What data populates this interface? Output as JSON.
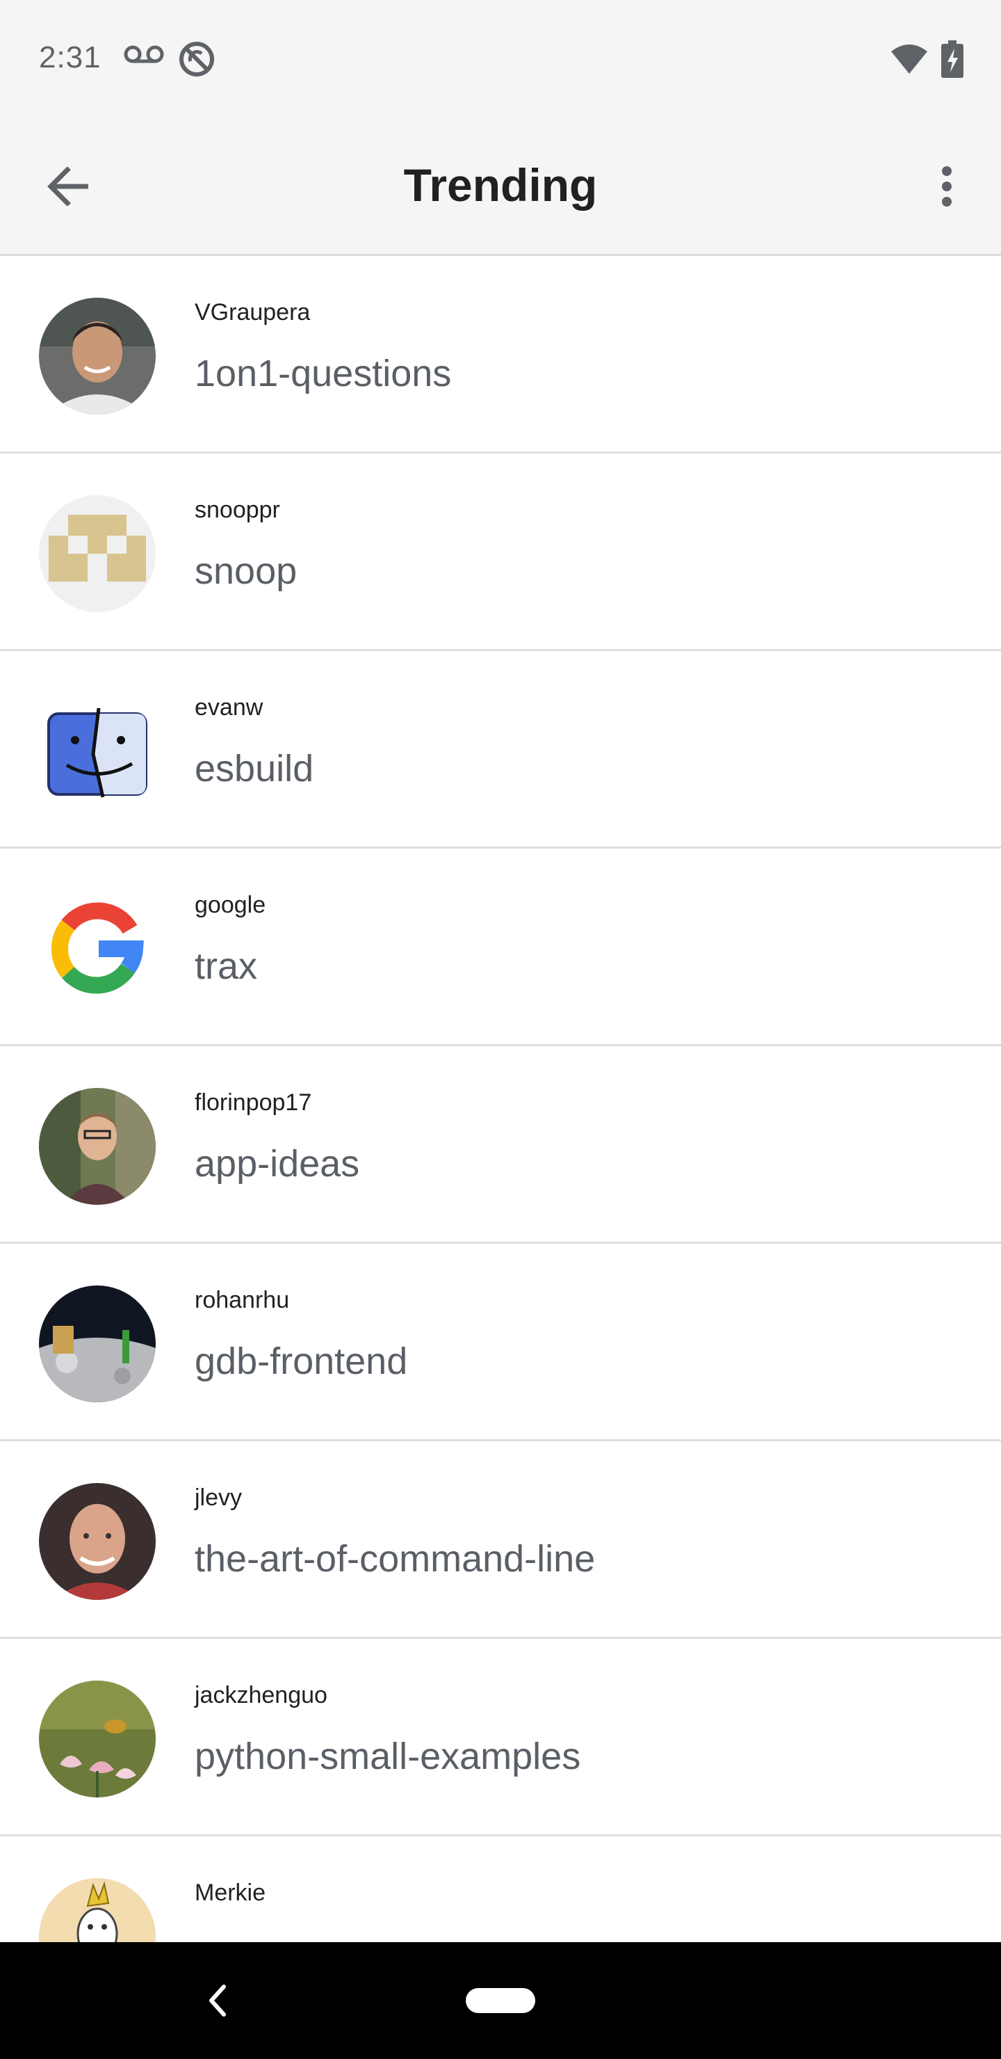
{
  "status_bar": {
    "time": "2:31",
    "icons": [
      "voicemail-icon",
      "sync-disabled-icon",
      "wifi-icon",
      "battery-charging-icon"
    ]
  },
  "app_bar": {
    "title": "Trending",
    "back_icon": "arrow-back-icon",
    "menu_icon": "more-vert-icon"
  },
  "repos": [
    {
      "owner": "VGraupera",
      "name": "1on1-questions"
    },
    {
      "owner": "snooppr",
      "name": "snoop"
    },
    {
      "owner": "evanw",
      "name": "esbuild"
    },
    {
      "owner": "google",
      "name": "trax"
    },
    {
      "owner": "florinpop17",
      "name": "app-ideas"
    },
    {
      "owner": "rohanrhu",
      "name": "gdb-frontend"
    },
    {
      "owner": "jlevy",
      "name": "the-art-of-command-line"
    },
    {
      "owner": "jackzhenguo",
      "name": "python-small-examples"
    },
    {
      "owner": "Merkie",
      "name": ""
    }
  ],
  "nav_bar": {
    "back_icon": "nav-back-icon",
    "home_icon": "nav-home-pill"
  }
}
